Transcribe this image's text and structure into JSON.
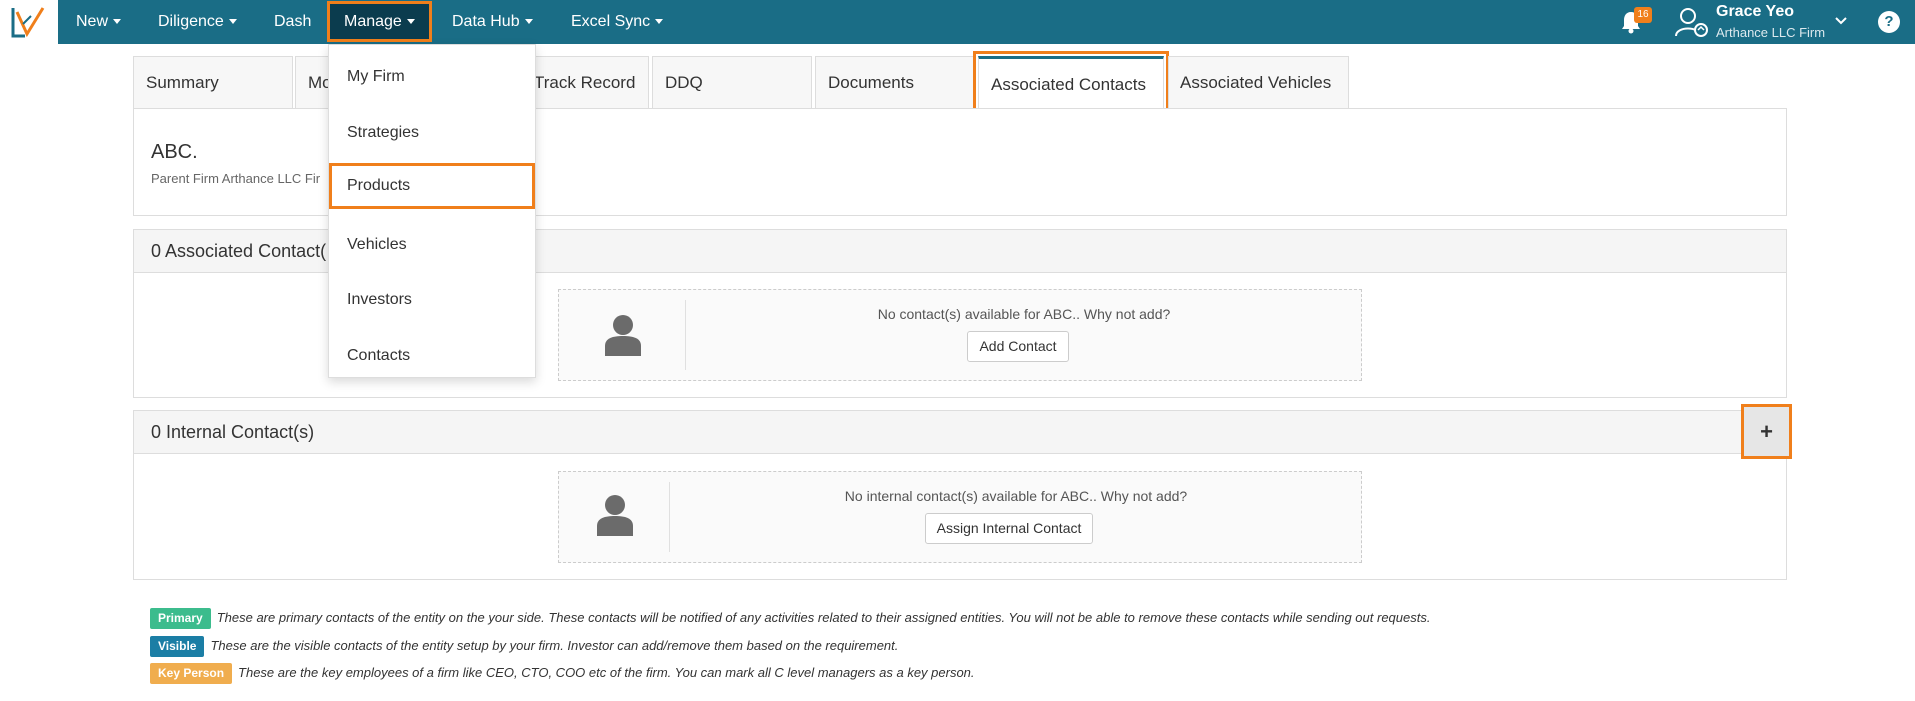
{
  "nav": {
    "items": [
      {
        "label": "New",
        "caret": true
      },
      {
        "label": "Diligence",
        "caret": true
      },
      {
        "label": "Dash",
        "caret": false
      },
      {
        "label": "Manage",
        "caret": true
      },
      {
        "label": "Data Hub",
        "caret": true
      },
      {
        "label": "Excel Sync",
        "caret": true
      }
    ],
    "notification_count": "16",
    "user_name": "Grace Yeo",
    "user_firm": "Arthance LLC Firm",
    "help": "?"
  },
  "dropdown": {
    "items": [
      "My Firm",
      "Strategies",
      "Products",
      "Vehicles",
      "Investors",
      "Contacts"
    ]
  },
  "tabs": [
    "Summary",
    "Mo",
    "Track Record",
    "DDQ",
    "Documents",
    "Associated Contacts",
    "Associated Vehicles"
  ],
  "entity": {
    "name": "ABC.",
    "parent": "Parent Firm Arthance LLC Fir"
  },
  "associated": {
    "header": "0 Associated Contact(",
    "empty_msg": "No contact(s) available for ABC.. Why not add?",
    "button": "Add Contact"
  },
  "internal": {
    "header": "0 Internal Contact(s)",
    "empty_msg": "No internal contact(s) available for ABC.. Why not add?",
    "button": "Assign Internal Contact",
    "add": "+"
  },
  "legend": [
    {
      "badge": "Primary",
      "color": "#3cbc8d",
      "text": "These are primary contacts of the entity on the your side. These contacts will be notified of any activities related to their assigned entities. You will not be able to remove these contacts while sending out requests."
    },
    {
      "badge": "Visible",
      "color": "#1b7ea5",
      "text": "These are the visible contacts of the entity setup by your firm. Investor can add/remove them based on the requirement."
    },
    {
      "badge": "Key Person",
      "color": "#f0ad4e",
      "text": "These are the key employees of a firm like CEO, CTO, COO etc of the firm. You can mark all C level managers as a key person."
    }
  ],
  "colors": {
    "brand": "#1a6d86",
    "highlight": "#f07f1b"
  }
}
